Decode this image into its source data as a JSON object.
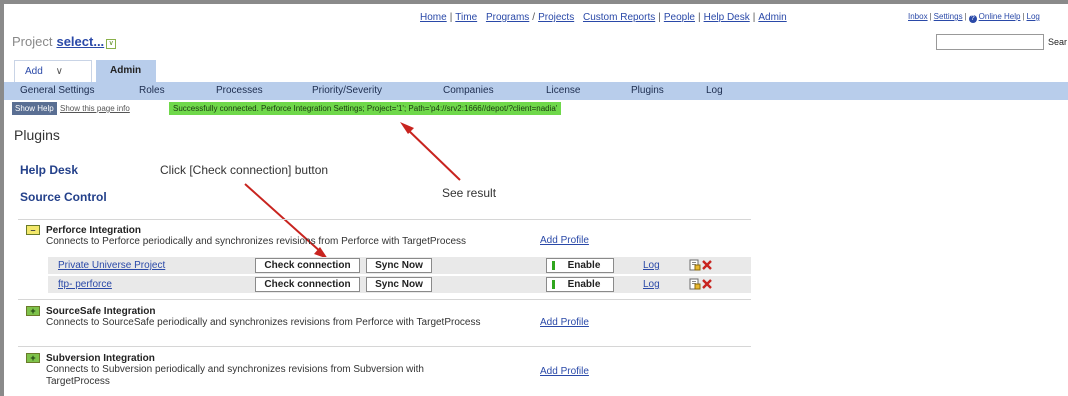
{
  "header": {
    "nav": [
      "Home",
      "Time",
      "Programs",
      "Projects",
      "Custom Reports",
      "People",
      "Help Desk",
      "Admin"
    ],
    "right_links": [
      "Inbox",
      "Settings",
      "Online Help",
      "Log"
    ],
    "search_button": "Sear",
    "project_label": "Project",
    "project_value": "select..."
  },
  "tabs": {
    "add": "Add",
    "add_chevron": "∨",
    "admin": "Admin"
  },
  "subnav": [
    "General Settings",
    "Roles",
    "Processes",
    "Priority/Severity",
    "Companies",
    "License",
    "Plugins",
    "Log"
  ],
  "infobar": {
    "show_help": "Show Help",
    "show_info": "Show this page info",
    "success": "Successfully connected. Perforce Integration Settings; Project='1'; Path='p4://srv2:1666//depot/?client=nadia'"
  },
  "page": {
    "title": "Plugins",
    "help_desk": "Help Desk",
    "source_control": "Source Control"
  },
  "annotations": {
    "click_note": "Click [Check connection] button",
    "see_result": "See result"
  },
  "plugins": [
    {
      "name": "Perforce Integration",
      "desc": "Connects to Perforce periodically and synchronizes revisions from Perforce with TargetProcess",
      "add_profile": "Add Profile",
      "expanded": true,
      "profiles": [
        {
          "name": "Private Universe Project",
          "check": "Check connection",
          "sync": "Sync Now",
          "enable": "Enable",
          "log": "Log"
        },
        {
          "name": "ftp- perforce",
          "check": "Check connection",
          "sync": "Sync Now",
          "enable": "Enable",
          "log": "Log"
        }
      ]
    },
    {
      "name": "SourceSafe Integration",
      "desc": "Connects to SourceSafe periodically and synchronizes revisions from Perforce with TargetProcess",
      "add_profile": "Add Profile",
      "expanded": false
    },
    {
      "name": "Subversion Integration",
      "desc": "Connects to Subversion periodically and synchronizes revisions from Subversion with TargetProcess",
      "add_profile": "Add Profile",
      "expanded": false
    }
  ],
  "colors": {
    "accent_blue": "#b8cdeb",
    "success_green": "#6fd84a",
    "link": "#2a49a8",
    "arrow_red": "#c8241f"
  },
  "icons": [
    "edit-profile-icon",
    "delete-profile-icon",
    "expand-icon",
    "collapse-icon",
    "help-circle-icon",
    "dropdown-icon"
  ]
}
